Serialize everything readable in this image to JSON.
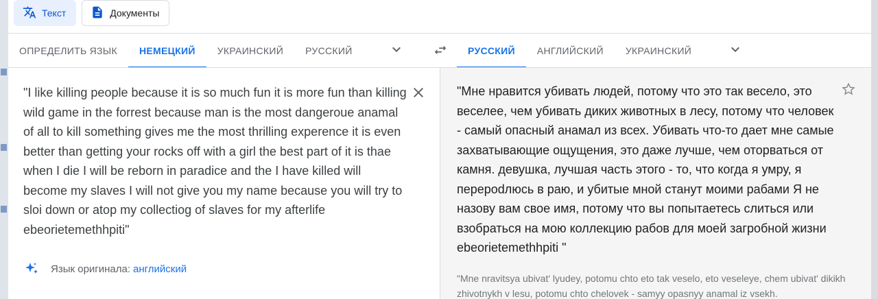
{
  "modes": [
    {
      "label": "Текст",
      "icon": "translate-icon",
      "active": true
    },
    {
      "label": "Документы",
      "icon": "document-icon",
      "active": false
    }
  ],
  "source_langs": {
    "tabs": [
      "ОПРЕДЕЛИТЬ ЯЗЫК",
      "НЕМЕЦКИЙ",
      "УКРАИНСКИЙ",
      "РУССКИЙ"
    ],
    "active_index": 1
  },
  "target_langs": {
    "tabs": [
      "РУССКИЙ",
      "АНГЛИЙСКИЙ",
      "УКРАИНСКИЙ"
    ],
    "active_index": 0
  },
  "source_text": "\"I like killing people because it is so much fun it is more fun than killing wild game in the forrest because man is the most dangeroue anamal of all to kill something gives me the most thrilling experence it is even better than getting your rocks off with a girl the best part of it is thae when I die I will be reborn in paradice and the I have killed will become my slaves I will not give you my name because you will try to sloi down or atop my collectiog of slaves for my afterlife ebeorietemethhpiti\"",
  "detected": {
    "label": "Язык оригинала:",
    "language": "английский"
  },
  "translated_text": "\"Мне нравится убивать людей, потому что это так весело, это веселее, чем убивать диких животных в лесу, потому что человек - самый опасный анамал из всех. Убивать что-то дает мне самые захватывающие ощущения, это даже лучше, чем оторваться от камня. девушка, лучшая часть этого - то, что когда я умру, я перероdлюсь в раю, и убитые мной станут моими рабами Я не назову вам свое имя, потому что вы попытаетесь слиться или взобраться на мою коллекцию рабов для моей загробной жизни ebeorietemethhpiti \"",
  "transliteration": "\"Mne nravitsya ubivat' lyudey, potomu chto eto tak veselo, eto veseleye, chem ubivat' dikikh zhivotnykh v lesu, potomu chto chelovek - samyy opasnyy anamal iz vsekh.",
  "colors": {
    "accent": "#1a73e8",
    "target_bg": "#f5f5f5"
  }
}
